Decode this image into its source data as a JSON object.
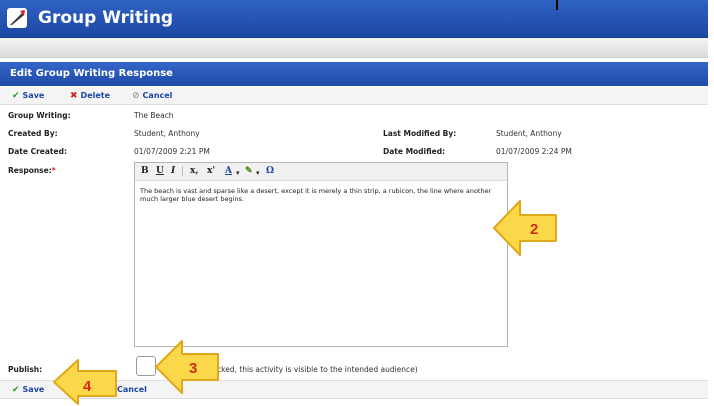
{
  "app": {
    "title": "Group Writing",
    "icon": "quill-pen-icon"
  },
  "panel": {
    "title": "Edit Group Writing Response"
  },
  "toolbar": {
    "save": "Save",
    "delete": "Delete",
    "cancel": "Cancel"
  },
  "fields": {
    "group_writing_label": "Group Writing:",
    "group_writing_value": "The Beach",
    "created_by_label": "Created By:",
    "created_by_value": "Student, Anthony",
    "last_modified_by_label": "Last Modified By:",
    "last_modified_by_value": "Student, Anthony",
    "date_created_label": "Date Created:",
    "date_created_value": "01/07/2009 2:21 PM",
    "date_modified_label": "Date Modified:",
    "date_modified_value": "01/07/2009 2:24 PM",
    "response_label": "Response:",
    "response_required_mark": "*",
    "response_text": "The beach is vast and sparse like a desert, except it is merely a thin strip, a rubicon, the line where another much larger blue desert begins.",
    "publish_label": "Publish:",
    "publish_checked": false,
    "publish_hint": "ticked, this activity is visible to the intended audience)"
  },
  "editor_toolbar": {
    "bold": "B",
    "underline": "U",
    "italic": "I",
    "subscript": "x,",
    "superscript": "x'",
    "font_color": "A",
    "omega": "Ω"
  },
  "bottom_toolbar": {
    "save": "Save",
    "cancel": "Cancel"
  },
  "callouts": [
    {
      "number": "2",
      "target": "response-editor"
    },
    {
      "number": "3",
      "target": "publish-checkbox"
    },
    {
      "number": "4",
      "target": "bottom-save-button"
    }
  ],
  "colors": {
    "header_blue": "#1c47a3",
    "link_blue": "#1d45a6",
    "callout_yellow": "#fbd74a"
  }
}
